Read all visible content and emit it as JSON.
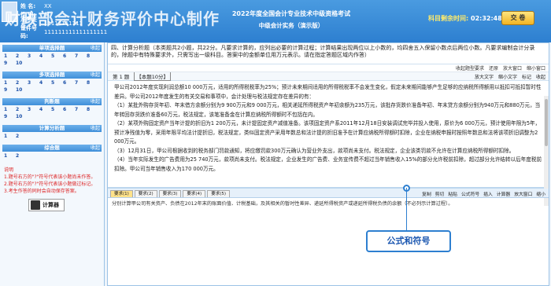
{
  "watermark": "财政部会计财务评价中心制作",
  "candidate": {
    "name_label": "姓 名:",
    "name_value": "XX",
    "gender_label": "性 别:",
    "gender_value": "男",
    "ticket_label": "准考证号:",
    "ticket_value": "11111111111",
    "id_label": "证件号码:",
    "id_value": "111111111111111111"
  },
  "exam": {
    "title": "2022年度全国会计专业技术中级资格考试",
    "subtitle": "中级会计实务（演示版）"
  },
  "timer": {
    "label": "科目剩余时间:",
    "value": "02:32:48"
  },
  "submit_label": "交 卷",
  "sections": [
    {
      "name": "单项选择题",
      "fold": "收起",
      "nums": [
        "1",
        "2",
        "3",
        "4",
        "5",
        "6",
        "7",
        "8",
        "9",
        "10"
      ]
    },
    {
      "name": "多项选择题",
      "fold": "收起",
      "nums": [
        "1",
        "2",
        "3",
        "4",
        "5",
        "6",
        "7",
        "8",
        "9",
        "10"
      ]
    },
    {
      "name": "判断题",
      "fold": "收起",
      "nums": [
        "1",
        "2",
        "3",
        "4",
        "5",
        "6",
        "7",
        "8",
        "9",
        "10"
      ]
    },
    {
      "name": "计算分析题",
      "fold": "收起",
      "nums": [
        "1",
        "2"
      ]
    },
    {
      "name": "综合题",
      "fold": "收起",
      "nums": [
        "1",
        "2"
      ]
    }
  ],
  "notes": {
    "title": "说明",
    "n1": "1.题号右方的\"?\"符号代表该小题尚未作答。",
    "n2": "2.题号右方的\"?\"符号代表该小题做过标记。",
    "n3": "3.考生作答的同时会自动保存答案。"
  },
  "calculator_label": "计算器",
  "instructions": "四、计算分析题（本类题共2小题，共22分。凡要求计算的，应列出必要的计算过程；计算结果出现两位以上小数的，均四舍五入保留小数点后两位小数。凡要求编制会计分录的，除题中有特殊要求外，只需写出一级科目。答案中的金额单位用万元表示。请在指定答题区域内作答）",
  "toolbar1": {
    "collapse": "收起题型要求",
    "restore": "还原",
    "enlarge": "放大窗口",
    "shrink": "缩小窗口"
  },
  "qhead": {
    "num": "第 1 题",
    "score": "【本题10分】",
    "enlarge_text": "放大文字",
    "shrink_text": "缩小文字",
    "mark": "标记",
    "collapse": "收起"
  },
  "question": {
    "p1": "甲公司2012年度实现利润总额10 000万元，适用的所得税税率为25%；预计未来期间适用的所得税税率不会发生变化，假定未来期间能够产生足够的应纳税所得额用以抵扣可抵扣暂时性差异。甲公司2012年度发生的有关交易和事项中，会计处理与税法规定存在差异的有：",
    "p2": "（1）某批外购存货年初、年末借方余额分别为9 900万元和9 000万元，相关递延所得税资产年初余额为235万元，该批存货跌价准备年初、年末贷方余额分别为940万元和880万元，当年转回存货跌价准备60万元，税法规定，该笔准备金在计算应纳税所得额时不包括在内。",
    "p3": "（2）某项外购固定资产当年计提的折旧为1 200万元，未计提固定资产减值准备。该项固定资产系2011年12月18日安装调试完毕并投入使用，原价为6 000万元，预计使用年限为5年，预计净残值为零，采用年限平均法计提折旧，税法规定，类似固定资产采用年数总和法计提的折旧准予在计算应纳税所得额时扣除，企业在纳税申报时按照年数总和法将该项折旧调整为2 000万元。",
    "p4": "（3）12月31日，甲公司根据收到的税务部门罚款通知，将应缴罚款300万元确认为营业外支出，款项尚未支付。税法规定，企业该类罚款不允许在计算应纳税所得额时扣除。",
    "p5": "（4）当年实际发生的广告费用为25 740万元，款项尚未支付。税法规定，企业发生的广告费、业务宣传费不超过当年销售收入15%的部分允许税前扣除，超过部分允许结转以后年度税前扣除。甲公司当年销售收入为170 000万元。"
  },
  "answer_tabs": [
    "要求(1)",
    "要求(2)",
    "要求(3)",
    "要求(4)",
    "要求(5)"
  ],
  "answer_tools": {
    "copy": "复制",
    "cut": "剪切",
    "paste": "粘贴",
    "formula": "公式符号",
    "insert": "插入",
    "calculator": "计算器",
    "enlarge": "放大窗口",
    "shrink": "缩小"
  },
  "answer_prompt": "分别计算甲公司有关资产、负债在2012年末的账面价值、计税基础，及其相关的暂时性差异、递延所得税资产或递延所得税负债的余额（不必列示计算过程）。",
  "tooltip": "公式和符号"
}
